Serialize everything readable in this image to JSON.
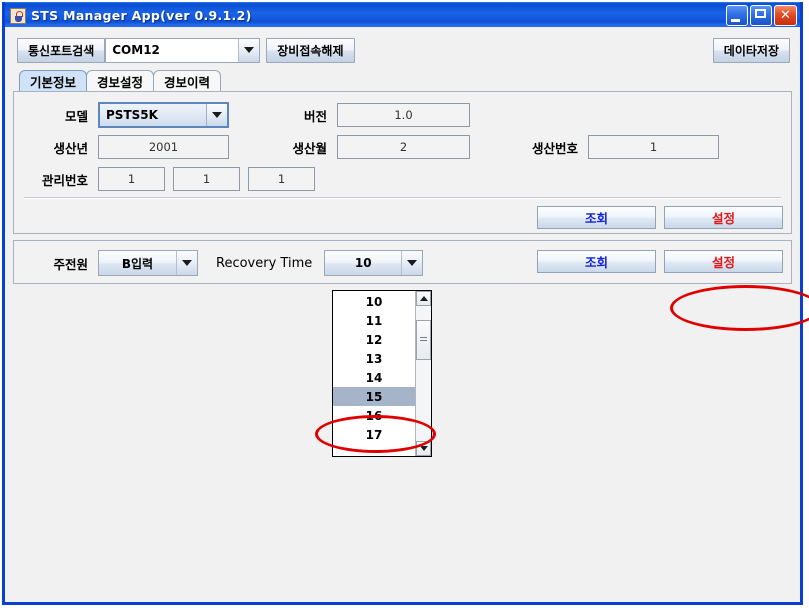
{
  "window": {
    "title": "STS Manager App(ver 0.9.1.2)",
    "icon": "java-cup-icon",
    "buttons": {
      "minimize": "minimize-icon",
      "maximize": "maximize-icon",
      "close": "✕"
    }
  },
  "toolbar": {
    "scan_port_label": "통신포트검색",
    "port_value": "COM12",
    "disconnect_label": "장비접속해제",
    "save_data_label": "데이타저장"
  },
  "tabs": [
    {
      "label": "기본정보",
      "active": true
    },
    {
      "label": "경보설정",
      "active": false
    },
    {
      "label": "경보이력",
      "active": false
    }
  ],
  "basic_panel": {
    "model": {
      "label": "모델",
      "value": "PSTS5K"
    },
    "version": {
      "label": "버전",
      "value": "1.0"
    },
    "prod_year": {
      "label": "생산년",
      "value": "2001"
    },
    "prod_month": {
      "label": "생산월",
      "value": "2"
    },
    "prod_number": {
      "label": "생산번호",
      "value": "1"
    },
    "mgmt_number": {
      "label": "관리번호",
      "values": [
        "1",
        "1",
        "1"
      ]
    },
    "query_label": "조회",
    "set_label": "설정"
  },
  "power_panel": {
    "main_power": {
      "label": "주전원",
      "value": "B입력"
    },
    "recovery_time": {
      "label": "Recovery Time",
      "value": "10"
    },
    "query_label": "조회",
    "set_label": "설정"
  },
  "dropdown": {
    "open": true,
    "selected": "15",
    "items": [
      "10",
      "11",
      "12",
      "13",
      "14",
      "15",
      "16",
      "17"
    ]
  },
  "annotations": [
    {
      "name": "highlight-set-button",
      "shape": "ellipse"
    },
    {
      "name": "highlight-dropdown-item-15",
      "shape": "ellipse"
    }
  ],
  "colors": {
    "accent_blue": "#0a3fd6",
    "query_text": "#1423cf",
    "set_text": "#e81414",
    "annotation_red": "#e00000",
    "selection": "#a5b4c8",
    "active_tab": "#cfe2f7"
  }
}
